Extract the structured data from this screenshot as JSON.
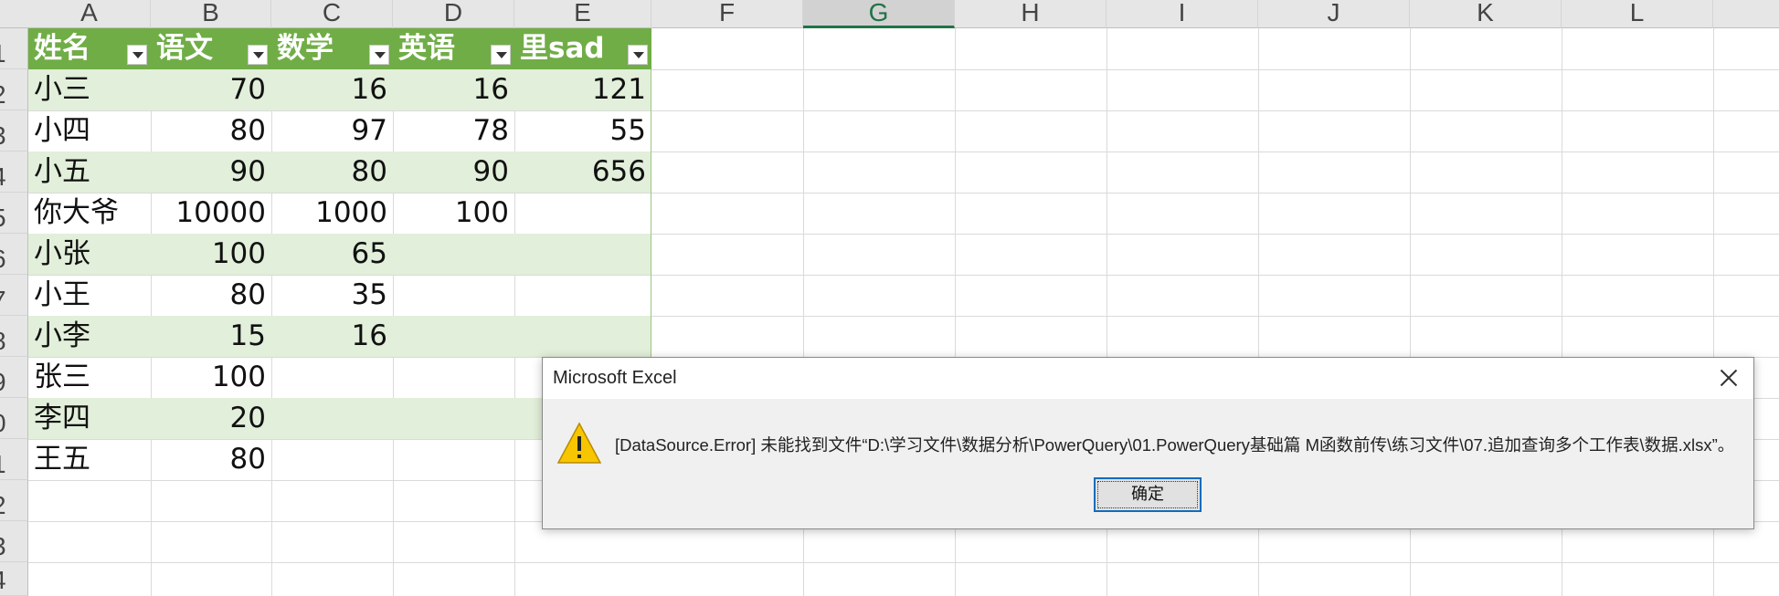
{
  "columns": [
    "A",
    "B",
    "C",
    "D",
    "E",
    "F",
    "G",
    "H",
    "I",
    "J",
    "K",
    "L"
  ],
  "rows": [
    "1",
    "2",
    "3",
    "4",
    "5",
    "6",
    "7",
    "8",
    "9",
    "0",
    "1",
    "2",
    "3",
    "4"
  ],
  "table": {
    "headers": [
      "姓名",
      "语文",
      "数学",
      "英语",
      "里sad"
    ],
    "data": [
      [
        "小三",
        "70",
        "16",
        "16",
        "121"
      ],
      [
        "小四",
        "80",
        "97",
        "78",
        "55"
      ],
      [
        "小五",
        "90",
        "80",
        "90",
        "656"
      ],
      [
        "你大爷",
        "10000",
        "1000",
        "100",
        ""
      ],
      [
        "小张",
        "100",
        "65",
        "",
        ""
      ],
      [
        "小王",
        "80",
        "35",
        "",
        ""
      ],
      [
        "小李",
        "15",
        "16",
        "",
        ""
      ],
      [
        "张三",
        "100",
        "",
        "",
        ""
      ],
      [
        "李四",
        "20",
        "",
        "",
        ""
      ],
      [
        "王五",
        "80",
        "",
        "",
        ""
      ]
    ]
  },
  "dialog": {
    "title": "Microsoft Excel",
    "message": "[DataSource.Error] 未能找到文件“D:\\学习文件\\数据分析\\PowerQuery\\01.PowerQuery基础篇 M函数前传\\练习文件\\07.追加查询多个工作表\\数据.xlsx”。",
    "ok_label": "确定",
    "icon": "warning-icon"
  },
  "colors": {
    "header_green": "#70ad47",
    "band_green": "#e2efda",
    "selected_col": "#217346"
  }
}
